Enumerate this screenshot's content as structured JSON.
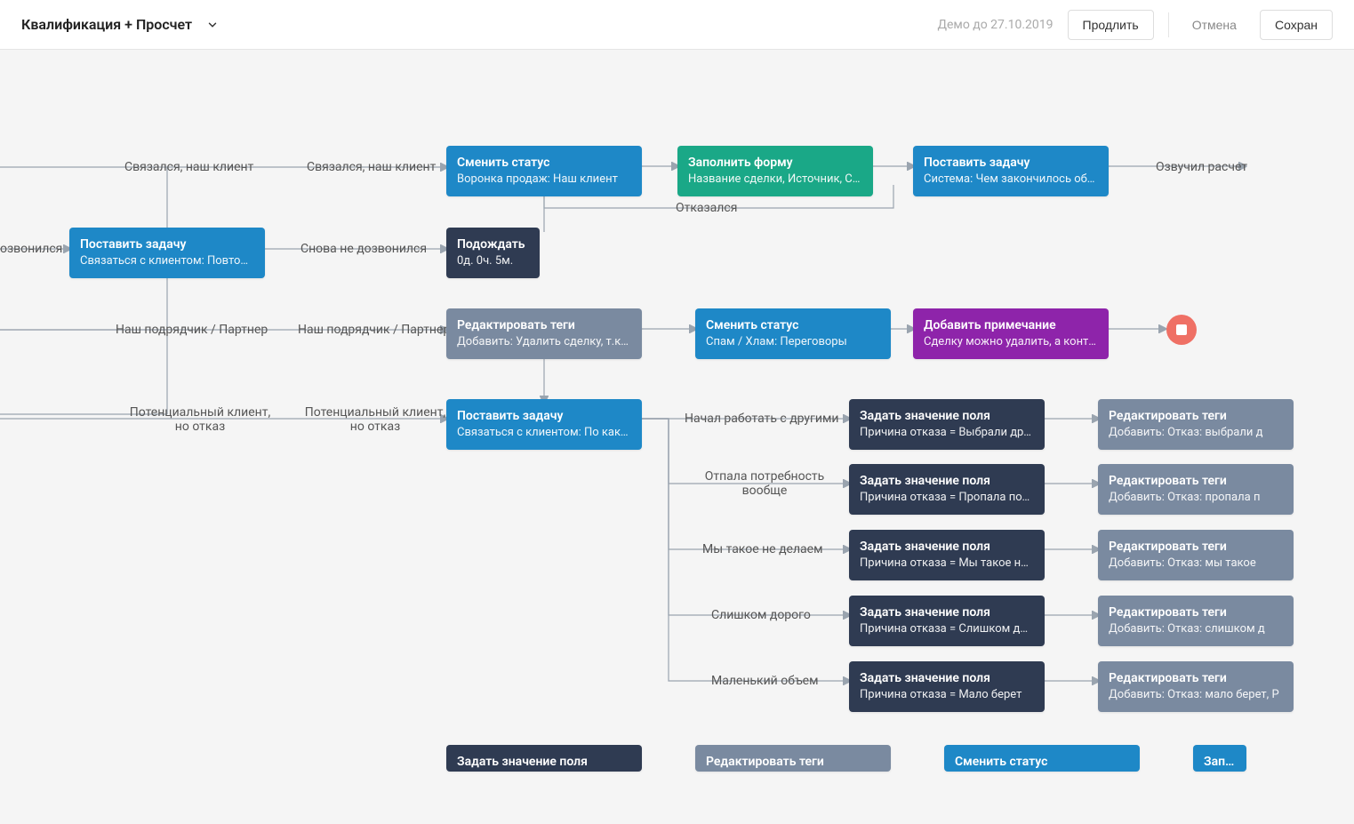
{
  "header": {
    "title": "Квалификация + Просчет",
    "demo_text": "Демо до 27.10.2019",
    "extend": "Продлить",
    "cancel": "Отмена",
    "save": "Сохран"
  },
  "labels": {
    "l_contacted_our_client_1": "Связался, наш клиент",
    "l_contacted_our_client_2": "Связался, наш клиент",
    "l_not_answered": "озвонился",
    "l_not_answered_again": "Снова не дозвонился",
    "l_our_contractor_1": "Наш подрядчик / Партнер",
    "l_our_contractor_2": "Наш подрядчик / Партнер",
    "l_potential_reject_1a": "Потенциальный клиент,",
    "l_potential_reject_1b": "но отказ",
    "l_potential_reject_2a": "Потенциальный клиент,",
    "l_potential_reject_2b": "но отказ",
    "l_refused": "Отказался",
    "l_voiced_calc": "Озвучил расчет",
    "l_started_others": "Начал работать с другими",
    "l_need_gone_a": "Отпала потребность",
    "l_need_gone_b": "вообще",
    "l_we_dont": "Мы такое не делаем",
    "l_too_expensive": "Слишком дорого",
    "l_small_volume": "Маленький объем"
  },
  "nodes": {
    "task_recall": {
      "t": "Поставить задачу",
      "s": "Связаться с клиентом: Повторна..."
    },
    "status_our_client": {
      "t": "Сменить статус",
      "s": "Воронка продаж: Наш клиент"
    },
    "fill_form": {
      "t": "Заполнить форму",
      "s": "Название сделки, Источник, СЕГ..."
    },
    "task_result": {
      "t": "Поставить задачу",
      "s": "Система: Чем закончилось обще..."
    },
    "wait": {
      "t": "Подождать",
      "s": "0д. 0ч. 5м."
    },
    "edit_tags_delete": {
      "t": "Редактировать теги",
      "s": "Добавить: Удалить сделку, т.к. па..."
    },
    "status_spam": {
      "t": "Сменить статус",
      "s": "Спам / Хлам: Переговоры"
    },
    "add_note": {
      "t": "Добавить примечание",
      "s": "Сделку можно удалить, а контакт..."
    },
    "task_why": {
      "t": "Поставить задачу",
      "s": "Связаться с клиентом: По какой ..."
    },
    "fv_others": {
      "t": "Задать значение поля",
      "s": "Причина отказа = Выбрали других"
    },
    "et_others": {
      "t": "Редактировать теги",
      "s": "Добавить: Отказ: выбрали д"
    },
    "fv_need_gone": {
      "t": "Задать значение поля",
      "s": "Причина отказа = Пропала потр..."
    },
    "et_need_gone": {
      "t": "Редактировать теги",
      "s": "Добавить: Отказ: пропала п"
    },
    "fv_we_dont": {
      "t": "Задать значение поля",
      "s": "Причина отказа = Мы такое не д..."
    },
    "et_we_dont": {
      "t": "Редактировать теги",
      "s": "Добавить: Отказ: мы такое"
    },
    "fv_expensive": {
      "t": "Задать значение поля",
      "s": "Причина отказа = Слишком доро..."
    },
    "et_expensive": {
      "t": "Редактировать теги",
      "s": "Добавить: Отказ: слишком д"
    },
    "fv_small": {
      "t": "Задать значение поля",
      "s": "Причина отказа = Мало берет"
    },
    "et_small": {
      "t": "Редактировать теги",
      "s": "Добавить: Отказ: мало берет, Р"
    },
    "bottom_fv": {
      "t": "Задать значение поля",
      "s": ""
    },
    "bottom_et": {
      "t": "Редактировать теги",
      "s": ""
    },
    "bottom_status": {
      "t": "Сменить статус",
      "s": ""
    },
    "bottom_start": {
      "t": "Запус",
      "s": ""
    }
  }
}
